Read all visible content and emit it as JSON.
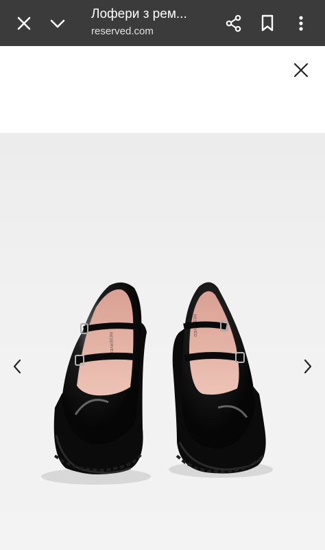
{
  "browser": {
    "title": "Лофери з рем...",
    "url": "reserved.com",
    "icons": {
      "close": "close-icon",
      "collapse": "chevron-down-icon",
      "share": "share-icon",
      "bookmark": "bookmark-icon",
      "menu": "more-vert-icon"
    },
    "colors": {
      "toolbar": "#3b3b3b",
      "text": "#ffffff"
    }
  },
  "viewer": {
    "close_icon": "close-icon",
    "prev_icon": "chevron-left-icon",
    "next_icon": "chevron-right-icon",
    "image": {
      "subject": "pair of black patent leather mary-jane loafers with two buckle straps",
      "brand_mark": "RESERVED",
      "colors": {
        "shoe": "#0d0d0d",
        "lining": "#e5b2a3",
        "background": "#efefef"
      }
    }
  }
}
